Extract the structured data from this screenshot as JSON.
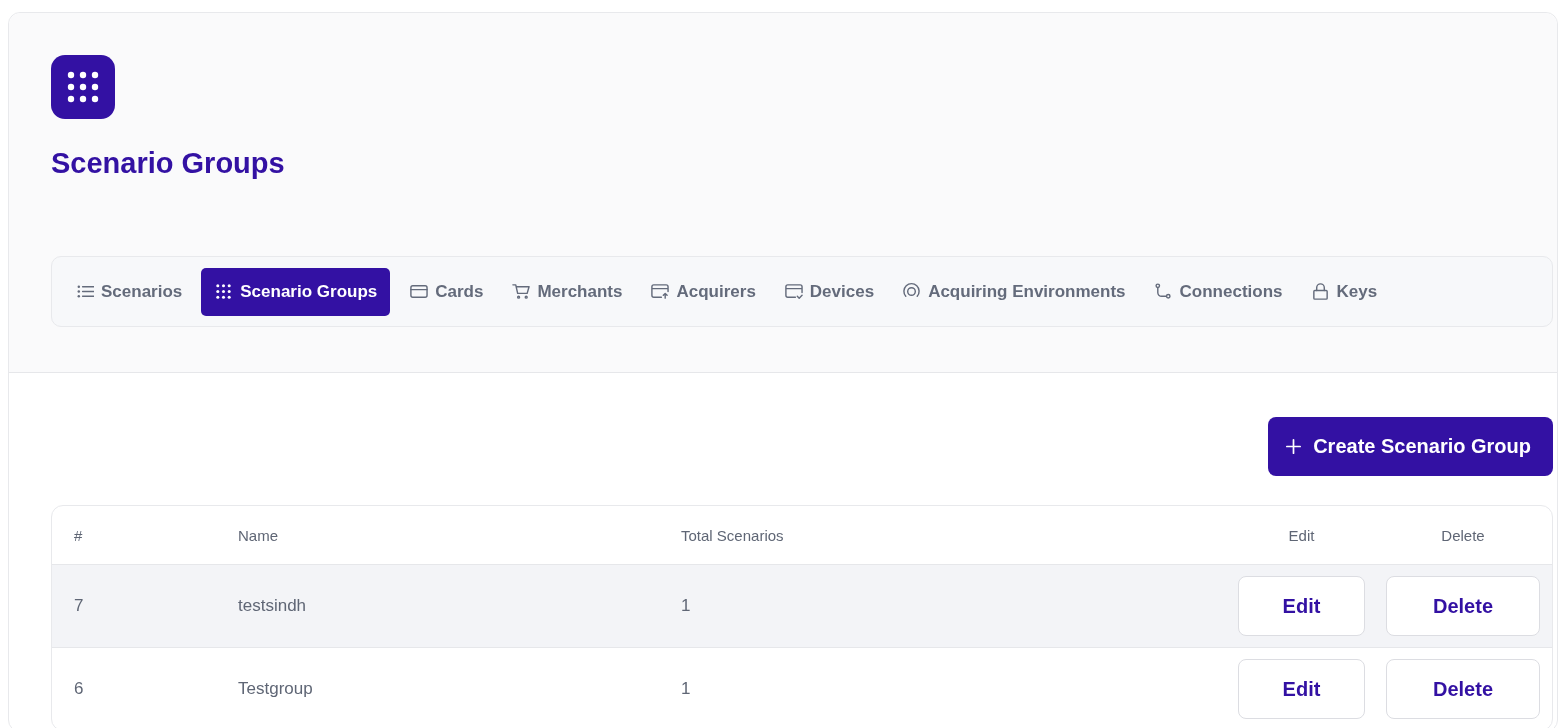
{
  "page": {
    "title": "Scenario Groups"
  },
  "tabs": [
    {
      "label": "Scenarios",
      "selected": false
    },
    {
      "label": "Scenario Groups",
      "selected": true
    },
    {
      "label": "Cards",
      "selected": false
    },
    {
      "label": "Merchants",
      "selected": false
    },
    {
      "label": "Acquirers",
      "selected": false
    },
    {
      "label": "Devices",
      "selected": false
    },
    {
      "label": "Acquiring Environments",
      "selected": false
    },
    {
      "label": "Connections",
      "selected": false
    },
    {
      "label": "Keys",
      "selected": false
    }
  ],
  "create_button": {
    "label": "Create Scenario Group"
  },
  "table": {
    "columns": [
      "#",
      "Name",
      "Total Scenarios",
      "Edit",
      "Delete"
    ],
    "rows": [
      {
        "id": "7",
        "name": "testsindh",
        "total": "1",
        "edit": "Edit",
        "delete": "Delete",
        "highlighted": true
      },
      {
        "id": "6",
        "name": "Testgroup",
        "total": "1",
        "edit": "Edit",
        "delete": "Delete",
        "highlighted": false
      }
    ]
  }
}
